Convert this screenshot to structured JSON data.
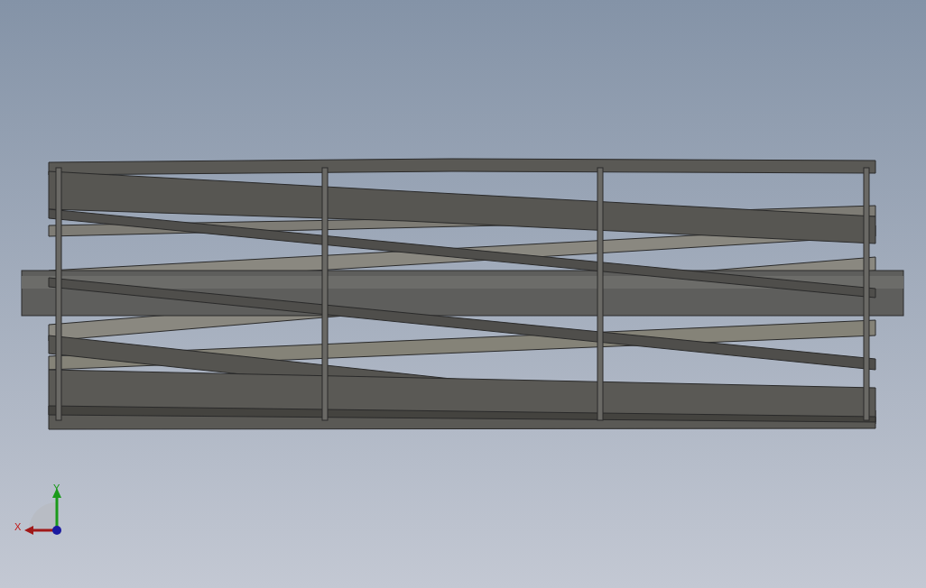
{
  "viewport": {
    "model": {
      "kind": "helical-reel"
    },
    "triad": {
      "x_label": "X",
      "y_label": "Y"
    }
  }
}
